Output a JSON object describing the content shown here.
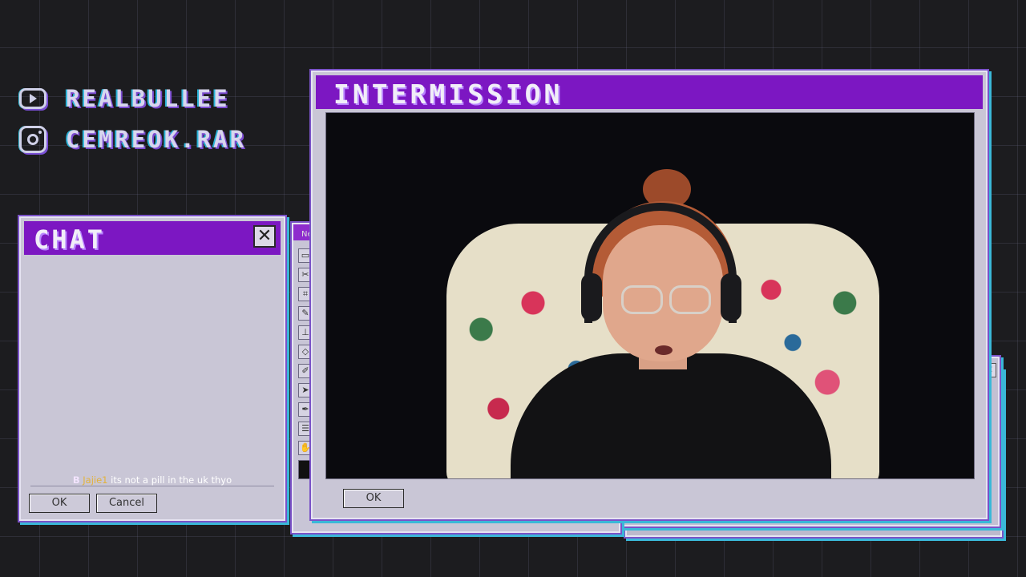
{
  "social": {
    "youtube": {
      "icon": "youtube-icon",
      "handle": "REALBULLEE"
    },
    "instagram": {
      "icon": "instagram-icon",
      "handle": "CEMREOK.RAR"
    }
  },
  "paint_window": {
    "title_partial": "Ne"
  },
  "chat_window": {
    "title": "CHAT",
    "close_label": "✕",
    "message": {
      "badge": "B",
      "username": "Jajie1",
      "text": "its not a pill in the uk thyo"
    },
    "ok_label": "OK",
    "cancel_label": "Cancel"
  },
  "intermission_window": {
    "title": "INTERMISSION",
    "ok_label": "OK"
  },
  "colors": {
    "titlebar": "#7c17c2",
    "window_bg": "#c9c6d6",
    "background": "#1c1c1f",
    "username": "#e3b23a"
  }
}
